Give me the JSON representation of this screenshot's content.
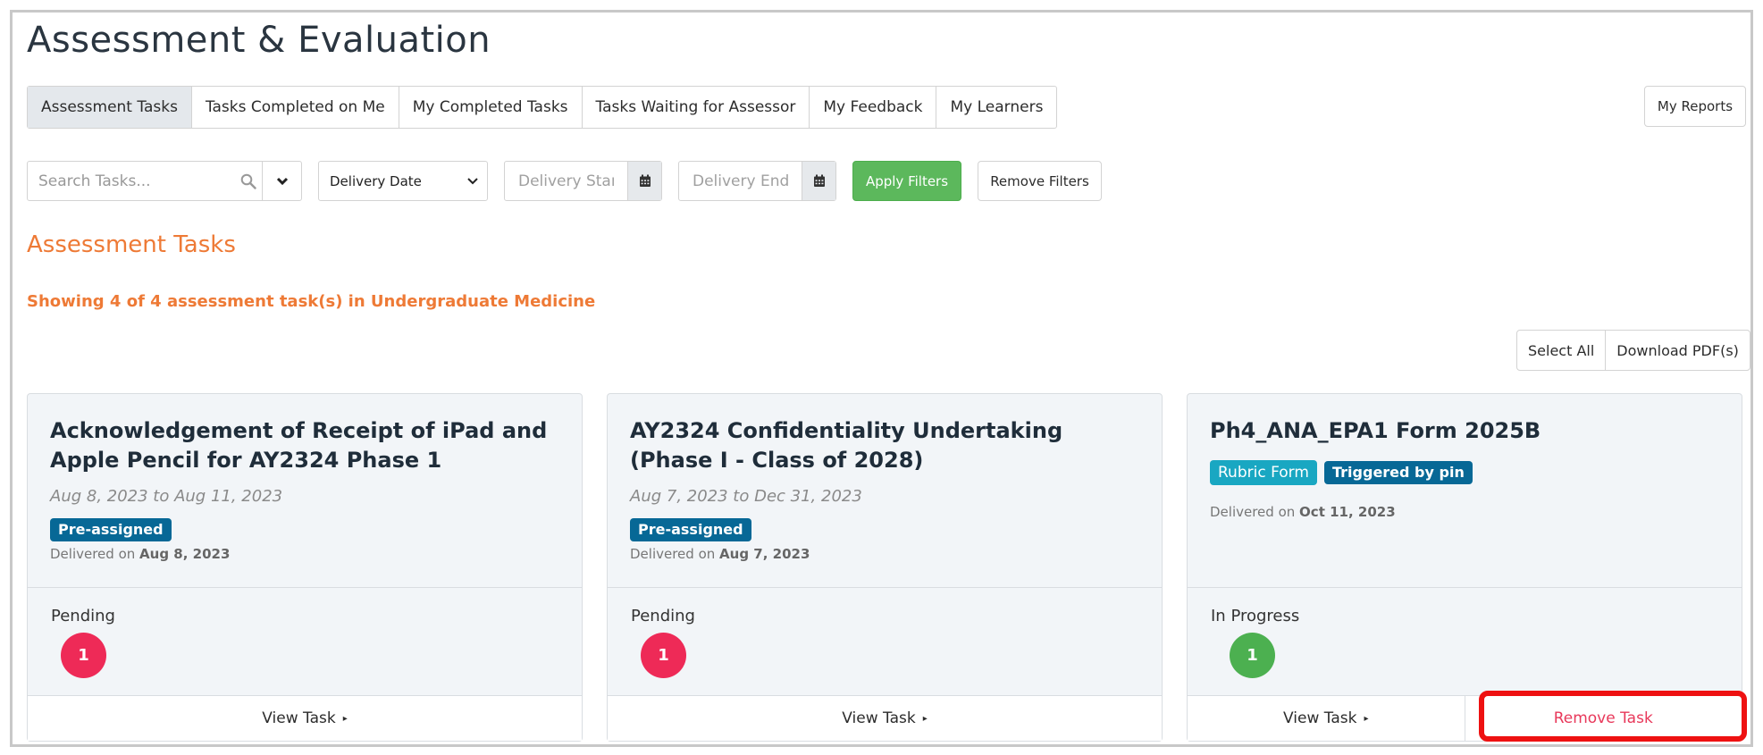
{
  "page": {
    "title": "Assessment & Evaluation"
  },
  "tabs": [
    {
      "label": "Assessment Tasks",
      "active": true
    },
    {
      "label": "Tasks Completed on Me"
    },
    {
      "label": "My Completed Tasks"
    },
    {
      "label": "Tasks Waiting for Assessor"
    },
    {
      "label": "My Feedback"
    },
    {
      "label": "My Learners"
    }
  ],
  "reports_button": "My Reports",
  "filters": {
    "search_placeholder": "Search Tasks...",
    "date_type_selected": "Delivery Date",
    "start_placeholder": "Delivery Start",
    "end_placeholder": "Delivery End",
    "apply_label": "Apply Filters",
    "remove_label": "Remove Filters"
  },
  "section": {
    "title": "Assessment Tasks",
    "showing": "Showing 4 of 4 assessment task(s) in Undergraduate Medicine",
    "select_all": "Select All",
    "download": "Download PDF(s)"
  },
  "cards": [
    {
      "title": "Acknowledgement of Receipt of iPad and Apple Pencil for AY2324 Phase 1",
      "dates": "Aug 8, 2023 to Aug 11, 2023",
      "badge": "Pre-assigned",
      "delivered_prefix": "Delivered on",
      "delivered_date": "Aug 8, 2023",
      "status": "Pending",
      "count": "1",
      "view_label": "View Task"
    },
    {
      "title": "AY2324 Confidentiality Undertaking (Phase I - Class of 2028)",
      "dates": "Aug 7, 2023 to Dec 31, 2023",
      "badge": "Pre-assigned",
      "delivered_prefix": "Delivered on",
      "delivered_date": "Aug 7, 2023",
      "status": "Pending",
      "count": "1",
      "view_label": "View Task"
    },
    {
      "title": "Ph4_ANA_EPA1 Form 2025B",
      "badge_rubric": "Rubric Form",
      "badge_trigger": "Triggered by pin",
      "delivered_prefix": "Delivered on",
      "delivered_date": "Oct 11, 2023",
      "status": "In Progress",
      "count": "1",
      "view_label": "View Task",
      "remove_label": "Remove Task"
    }
  ],
  "colors": {
    "accent_orange": "#ee7a36",
    "badge_blue": "#076896",
    "badge_teal": "#19a7c2",
    "pending_red": "#ee2a57",
    "progress_green": "#4cb050",
    "apply_green": "#5cb85c",
    "highlight_red": "#ee1111"
  }
}
